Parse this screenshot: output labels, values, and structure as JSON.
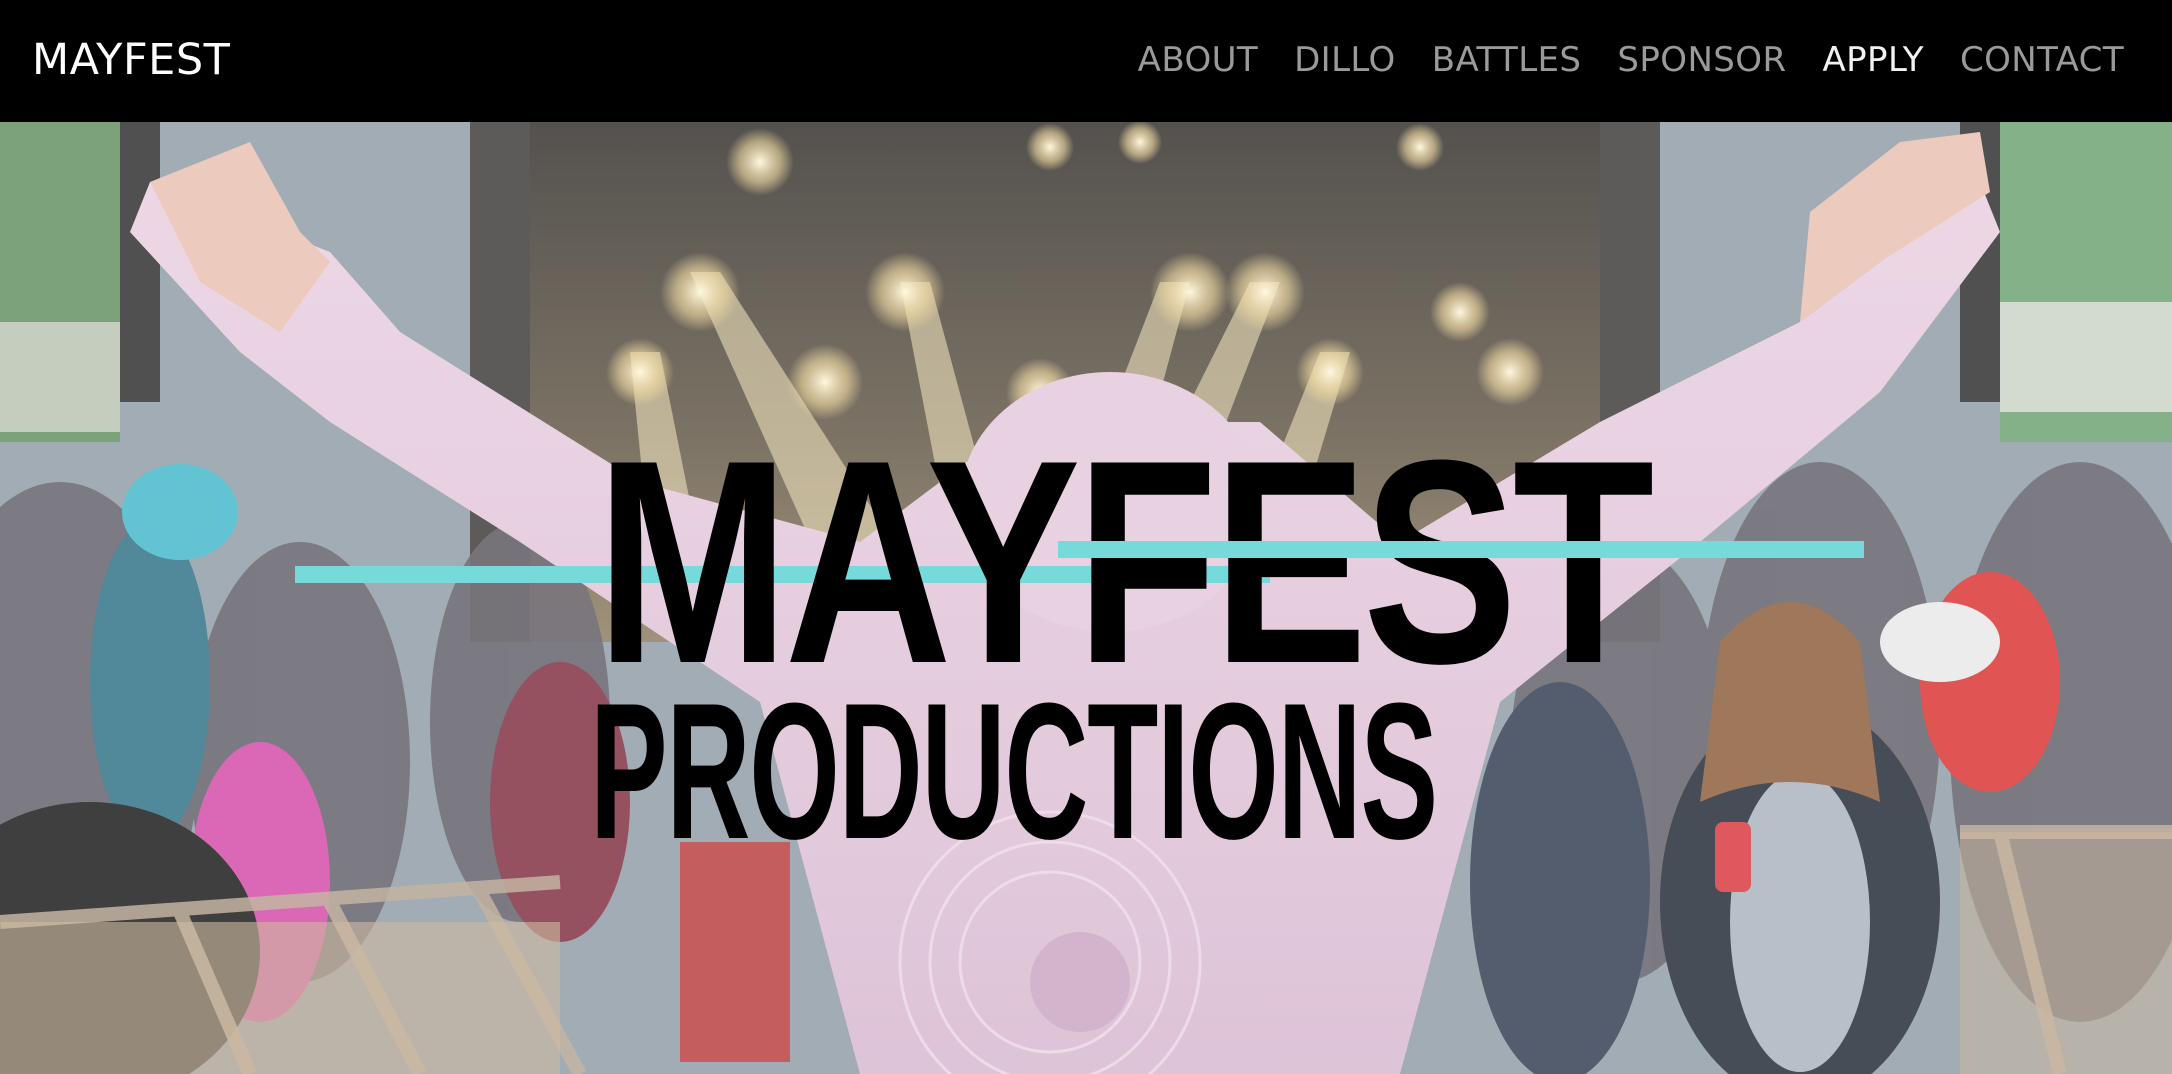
{
  "header": {
    "brand": "MAYFEST",
    "nav": [
      {
        "label": "ABOUT"
      },
      {
        "label": "DILLO"
      },
      {
        "label": "BATTLES"
      },
      {
        "label": "SPONSOR"
      },
      {
        "label": "APPLY",
        "active": true
      },
      {
        "label": "CONTACT"
      }
    ]
  },
  "hero": {
    "logo_line1": "MAYFEST",
    "logo_line2": "PRODUCTIONS",
    "accent_color": "#76dada",
    "photo_subject": "crowd at outdoor concert stage, person in pink hoodie with arms raised"
  }
}
